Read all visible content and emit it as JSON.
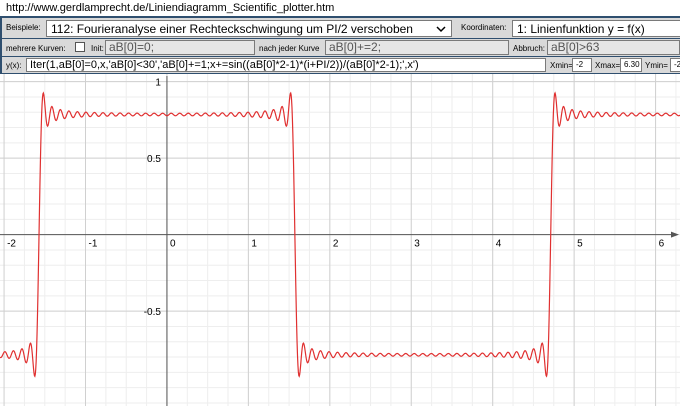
{
  "browser": {
    "url": "http://www.gerdlamprecht.de/Liniendiagramm_Scientific_plotter.htm"
  },
  "controls": {
    "examples_label": "Beispiele:",
    "examples_value": "112: Fourieranalyse einer Rechteckschwingung um PI/2 verschoben",
    "coords_label": "Koordinaten:",
    "coords_value": "1: Linienfunktion y = f(x)",
    "multi_curves_label": "mehrere Kurven:",
    "init_label": "Init:",
    "init_value": "aB[0]=0;",
    "after_curve_label": "nach jeder Kurve",
    "after_curve_value": "aB[0]+=2;",
    "abort_label": "Abbruch:",
    "abort_value": "aB[0]>63",
    "y_label": "y(x):",
    "y_formula": "Iter(1,aB[0]=0,x,'aB[0]<30','aB[0]+=1;x+=sin((aB[0]*2-1)*(i+PI/2))/(aB[0]*2-1);',x')",
    "xmin_label": "Xmin=",
    "xmin_value": "-2",
    "xmax_label": "Xmax=",
    "xmax_value": "6.30",
    "ymin_label": "Ymin=",
    "ymin_value": "-2"
  },
  "colors": {
    "panel": "#2f4f6f",
    "curve": "#e03030",
    "grid": "#d0d0d0",
    "axis": "#555555"
  },
  "chart_data": {
    "type": "line",
    "xlim": [
      -2.05,
      6.3
    ],
    "ylim": [
      -1.12,
      1.05
    ],
    "grid": true,
    "x_ticks": [
      -2,
      -1,
      0,
      1,
      2,
      3,
      4,
      5,
      6
    ],
    "y_ticks": [
      1,
      0.5,
      -0.5
    ],
    "x_tick_labels": [
      "-2",
      "-1",
      "0",
      "1",
      "2",
      "3",
      "4",
      "5",
      "6"
    ],
    "y_tick_labels": [
      "1",
      "0.5",
      "-0.5"
    ],
    "x_zero_label": "0",
    "series": [
      {
        "function": "partial Fourier sum of square wave: sum_{n=1..30} sin((2n-1)(x+pi/2))/(2n-1)",
        "x_range": [
          -2.05,
          6.3
        ],
        "color": "#e03030"
      }
    ]
  }
}
